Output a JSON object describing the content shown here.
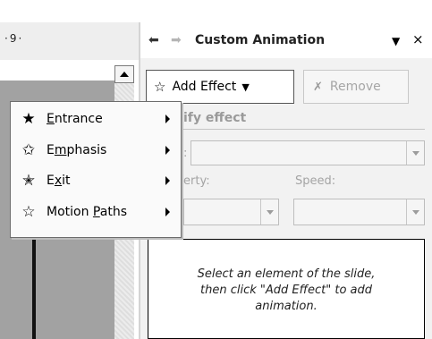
{
  "ruler": {
    "text": "9"
  },
  "pane": {
    "title": "Custom Animation",
    "back_icon": "back-arrow",
    "forward_icon": "forward-arrow",
    "menu_icon": "caret-down",
    "close_label": "×"
  },
  "toolbar": {
    "add_effect_label": "Add Effect",
    "remove_label": "Remove"
  },
  "modify": {
    "heading_visible": "ify effect",
    "start_visible": ":",
    "property_visible": "erty:",
    "speed_label": "Speed:"
  },
  "list": {
    "hint_line1": "Select an element of the slide,",
    "hint_line2": "then click \"Add Effect\" to add",
    "hint_line3": "animation."
  },
  "menu": {
    "items": [
      {
        "label": "Entrance",
        "accel_index": 0,
        "icon": "entrance-star-icon"
      },
      {
        "label": "Emphasis",
        "accel_index": 1,
        "icon": "emphasis-star-icon"
      },
      {
        "label": "Exit",
        "accel_index": 1,
        "icon": "exit-star-icon"
      },
      {
        "label": "Motion Paths",
        "accel_index": 7,
        "icon": "motion-path-star-icon"
      }
    ]
  },
  "colors": {
    "pane_bg": "#f2f2f2",
    "slide_gray": "#a2a2a2",
    "disabled_text": "#a4a4a4"
  }
}
